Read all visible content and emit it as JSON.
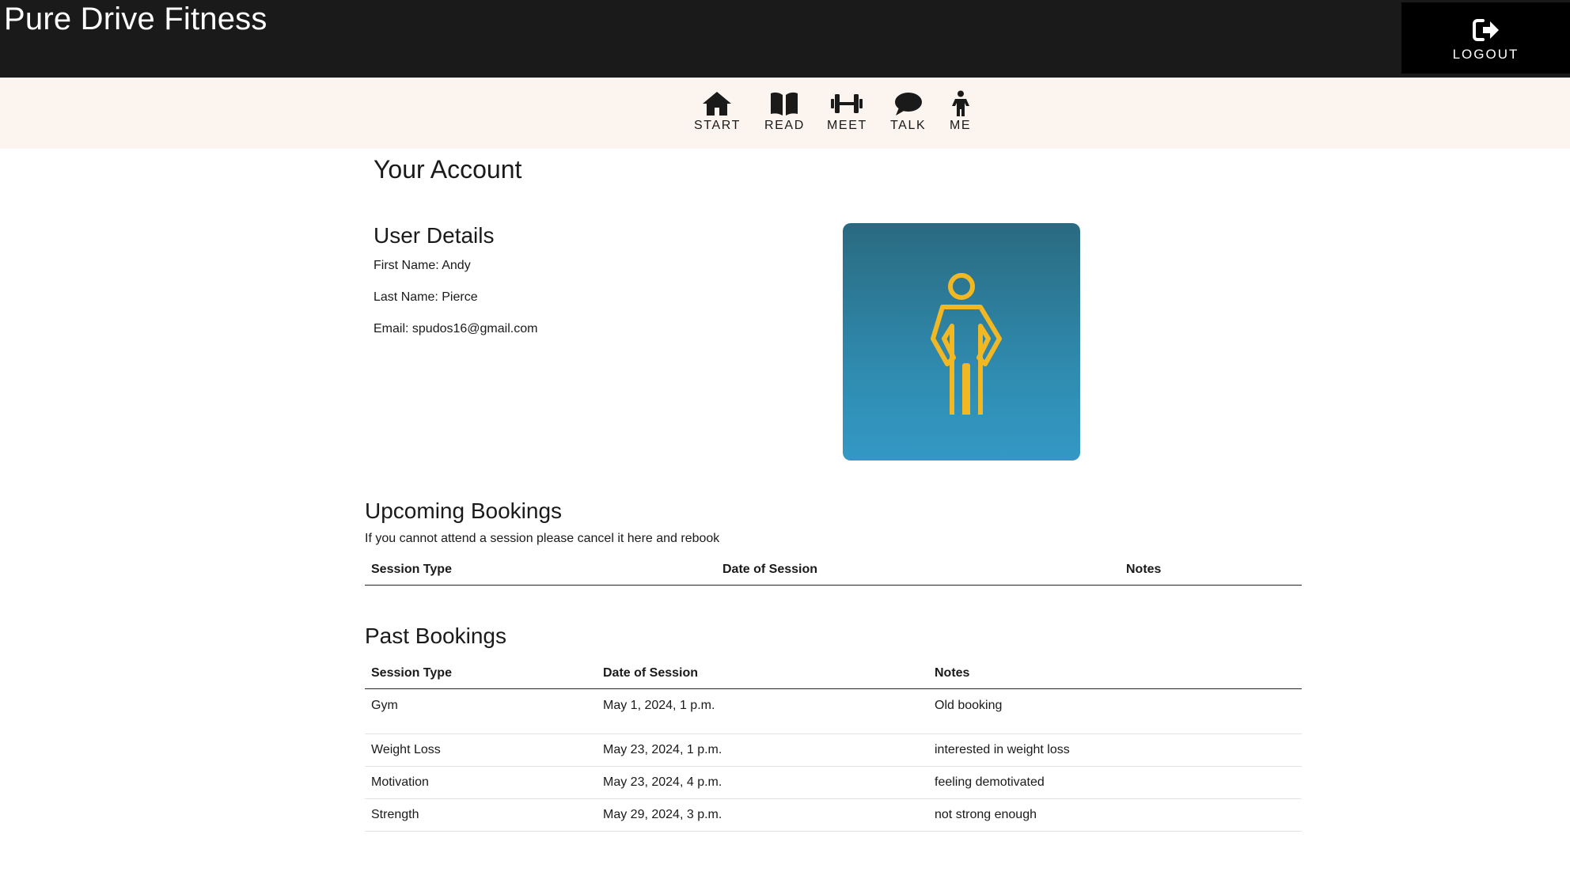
{
  "header": {
    "brand": "Pure Drive Fitness",
    "logout_label": "LOGOUT",
    "logout_icon": "sign-out-icon"
  },
  "nav": {
    "items": [
      {
        "label": "START",
        "icon": "home-icon"
      },
      {
        "label": "READ",
        "icon": "book-icon"
      },
      {
        "label": "MEET",
        "icon": "dumbbell-icon"
      },
      {
        "label": "TALK",
        "icon": "speech-bubble-icon"
      },
      {
        "label": "ME",
        "icon": "person-icon"
      }
    ]
  },
  "account": {
    "title": "Your Account",
    "user_details_title": "User Details",
    "first_name": "First Name: Andy",
    "last_name": "Last Name: Pierce",
    "email": "Email: spudos16@gmail.com",
    "avatar_icon": "standing-person-icon",
    "avatar_colors": {
      "top": "#2a6a80",
      "bottom": "#3399c4",
      "figure": "#f2b824"
    }
  },
  "upcoming": {
    "title": "Upcoming Bookings",
    "note": "If you cannot attend a session please cancel it here and rebook",
    "columns": [
      "Session Type",
      "Date of Session",
      "Notes"
    ],
    "rows": []
  },
  "past": {
    "title": "Past Bookings",
    "columns": [
      "Session Type",
      "Date of Session",
      "Notes"
    ],
    "rows": [
      [
        "Gym",
        "May 1, 2024, 1 p.m.",
        "Old booking"
      ],
      [
        "Weight Loss",
        "May 23, 2024, 1 p.m.",
        "interested in weight loss"
      ],
      [
        "Motivation",
        "May 23, 2024, 4 p.m.",
        "feeling demotivated"
      ],
      [
        "Strength",
        "May 29, 2024, 3 p.m.",
        "not strong enough"
      ]
    ]
  }
}
